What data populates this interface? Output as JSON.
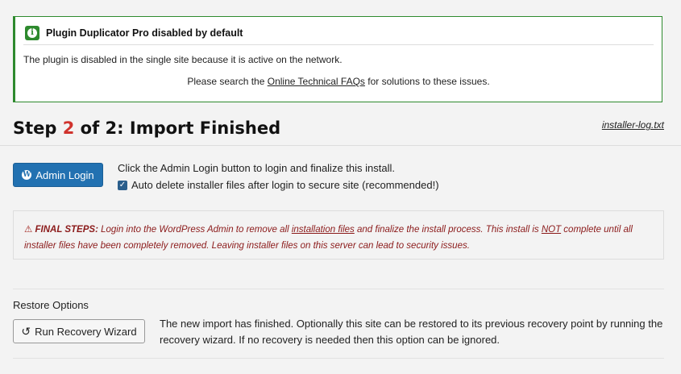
{
  "notice": {
    "title": "Plugin Duplicator Pro disabled by default",
    "message": "The plugin is disabled in the single site because it is active on the network.",
    "faq_prefix": "Please search the ",
    "faq_link": "Online Technical FAQs",
    "faq_suffix": " for solutions to these issues."
  },
  "step": {
    "prefix": "Step ",
    "number": "2",
    "suffix": " of 2: Import Finished",
    "log_link": "installer-log.txt"
  },
  "admin": {
    "button_label": "Admin Login",
    "info": "Click the Admin Login button to login and finalize this install.",
    "auto_delete_label": "Auto delete installer files after login to secure site (recommended!)",
    "auto_delete_checked": true
  },
  "final_steps": {
    "label": "FINAL STEPS:",
    "text1": " Login into the WordPress Admin to remove all ",
    "link1": "installation files",
    "text2": " and finalize the install process. This install is ",
    "not_word": "NOT",
    "text3": " complete until all installer files have been completely removed. Leaving installer files on this server can lead to security issues."
  },
  "restore": {
    "label": "Restore Options",
    "button_label": "Run Recovery Wizard",
    "description": "The new import has finished. Optionally this site can be restored to its previous recovery point by running the recovery wizard. If no recovery is needed then this option can be ignored."
  },
  "icons": {
    "info": "info-icon",
    "wordpress": "wordpress-icon",
    "warning": "warning-icon",
    "undo": "undo-icon",
    "check": "checkmark-icon"
  },
  "colors": {
    "notice_border": "#2e8a2e",
    "step_number": "#d0332d",
    "primary_button": "#2271b1",
    "final_steps_text": "#8b1a1a"
  }
}
